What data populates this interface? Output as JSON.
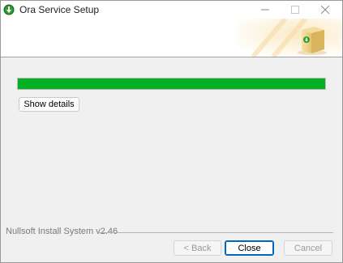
{
  "window": {
    "title": "Ora Service Setup",
    "icon": "green-download-arrow-icon"
  },
  "titlebar_buttons": {
    "minimize": "—",
    "maximize": "☐",
    "close": "✕"
  },
  "progress": {
    "value_percent": 100,
    "fill_color": "#06b025"
  },
  "details_button": {
    "label": "Show details"
  },
  "footer": {
    "branding": "Nullsoft Install System v2.46",
    "back_label": "< Back",
    "close_label": "Close",
    "cancel_label": "Cancel"
  }
}
